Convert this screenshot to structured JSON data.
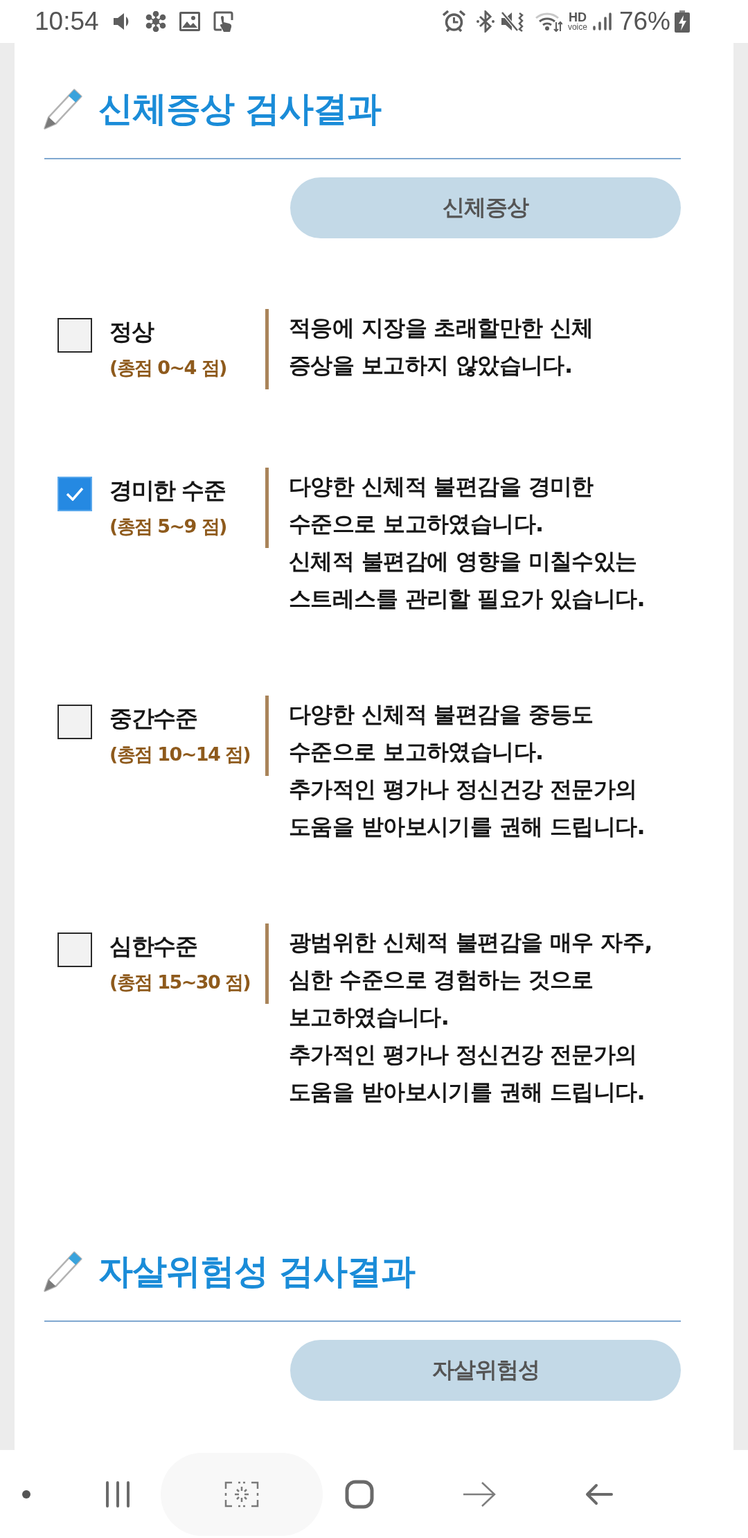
{
  "status_bar": {
    "time": "10:54",
    "hd_label": "HD",
    "voice_label": "voice",
    "battery_percent": "76%"
  },
  "sections": [
    {
      "title": "신체증상 검사결과",
      "category": "신체증상",
      "items": [
        {
          "checked": false,
          "label": "정상",
          "score": "(총점 0~4 점)",
          "description": [
            "적응에 지장을 초래할만한 신체",
            "증상을 보고하지 않았습니다."
          ]
        },
        {
          "checked": true,
          "label": "경미한 수준",
          "score": "(총점 5~9 점)",
          "description": [
            "다양한 신체적 불편감을 경미한",
            "수준으로 보고하였습니다.",
            "신체적 불편감에 영향을 미칠수있는",
            "스트레스를 관리할 필요가 있습니다."
          ]
        },
        {
          "checked": false,
          "label": "중간수준",
          "score": "(총점 10~14 점)",
          "description": [
            "다양한 신체적 불편감을 중등도",
            "수준으로 보고하였습니다.",
            "추가적인 평가나 정신건강 전문가의",
            "도움을 받아보시기를 권해 드립니다."
          ]
        },
        {
          "checked": false,
          "label": "심한수준",
          "score": "(총점 15~30 점)",
          "description": [
            "광범위한 신체적 불편감을 매우 자주,",
            "심한 수준으로 경험하는 것으로",
            "보고하였습니다.",
            "추가적인 평가나 정신건강 전문가의",
            "도움을 받아보시기를 권해 드립니다."
          ]
        }
      ]
    },
    {
      "title": "자살위험성 검사결과",
      "category": "자살위험성"
    }
  ]
}
